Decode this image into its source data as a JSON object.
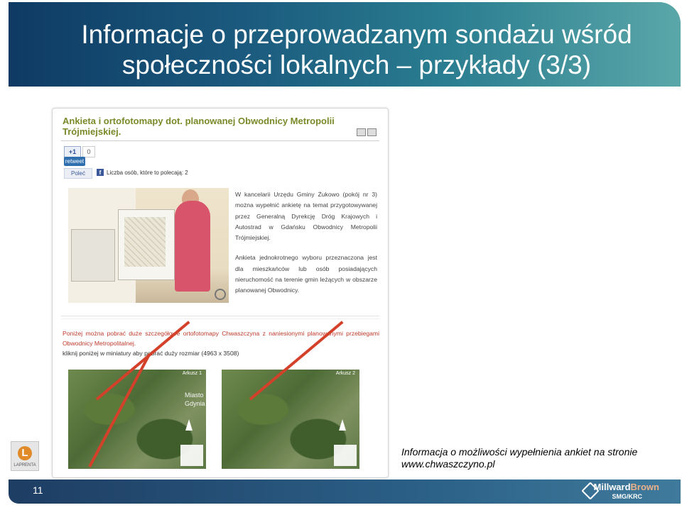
{
  "slide": {
    "title": "Informacje o przeprowadzanym sondażu wśród społeczności lokalnych – przykłady (3/3)",
    "page_number": "11",
    "info_line1": "Informacja o możliwości wypełnienia ankiet na stronie",
    "info_line2": "www.chwaszczyno.pl"
  },
  "article": {
    "title": "Ankieta i ortofotomapy dot. planowanej Obwodnicy Metropolii Trójmiejskiej.",
    "gplus_label": "+1",
    "gplus_count": "0",
    "retweet_label": "retweet",
    "fb_like_label": "Poleć",
    "fb_count_text": "Liczba osób, które to polecają: 2",
    "paragraph1": "W kancelarii Urzędu Gminy Żukowo (pokój nr 3) można wypełnić ankietę na temat przygotowywanej przez Generalną Dyrekcję Dróg Krajowych i Autostrad w Gdańsku Obwodnicy Metropolii Trójmiejskiej.",
    "paragraph2": "Ankieta jednokrotnego wyboru przeznaczona jest dla mieszkańców lub osób posiadających nieruchomość na terenie gmin leżących w obszarze planowanej Obwodnicy.",
    "download_text": "Poniżej można pobrać duże szczegółowe ortofotomapy Chwaszczyna z naniesionymi planowanymi przebiegami Obwodnicy Metropolitalnej.",
    "download_hint": "kliknij poniżej w miniatury aby pobrać duży rozmiar (4963 x 3508)",
    "map1_label": "Arkusz 1",
    "map1_city": "Miasto Gdynia",
    "map2_label": "Arkusz 2"
  },
  "logo": {
    "letter": "L",
    "caption": "LAPRENTA"
  },
  "footer": {
    "brand_main": "Millward",
    "brand_accent": "Brown",
    "brand_sub": "SMG/KRC"
  }
}
